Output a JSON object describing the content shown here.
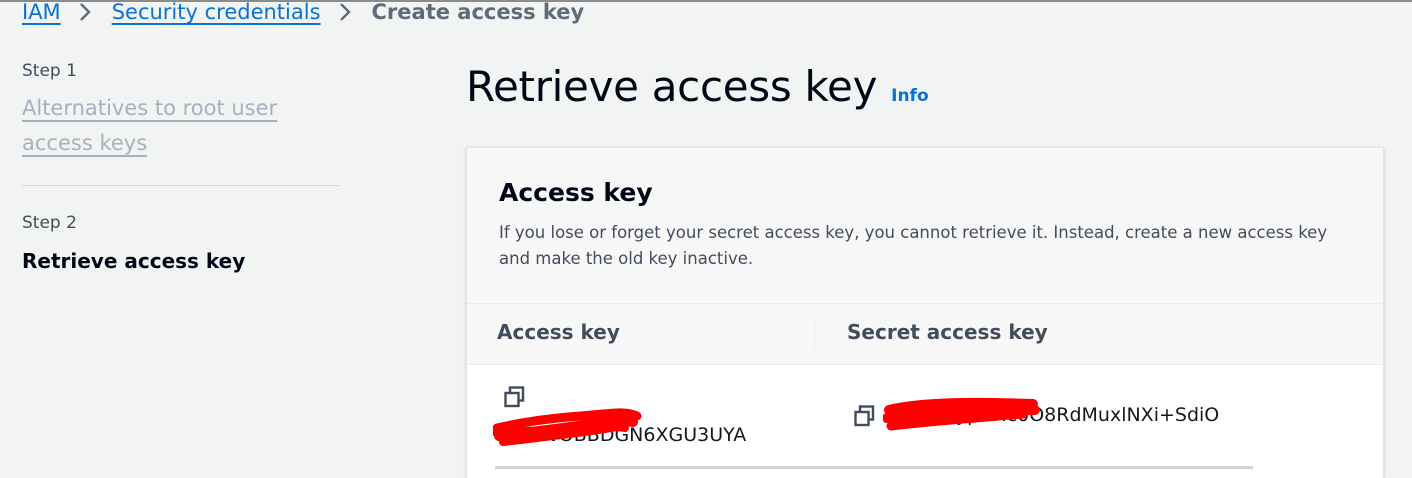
{
  "breadcrumb": {
    "items": [
      "IAM",
      "Security credentials"
    ],
    "current": "Create access key"
  },
  "side_nav": {
    "step1_label": "Step 1",
    "step1_title": "Alternatives to root user access keys",
    "step2_label": "Step 2",
    "step2_title": "Retrieve access key"
  },
  "page": {
    "title": "Retrieve access key",
    "info_label": "Info"
  },
  "panel": {
    "title": "Access key",
    "description": "If you lose or forget your secret access key, you cannot retrieve it. Instead, create a new access key and make the old key inactive.",
    "columns": [
      "Access key",
      "Secret access key"
    ],
    "access_key_value": "AKIAWOBBDGN6XGU3UYA",
    "secret_access_key_value": "Agi+giiypRHc0O8RdMuxlNXi+SdiO"
  },
  "colors": {
    "link": "#0972d3",
    "redaction": "#ff0000",
    "background": "#f2f3f3"
  },
  "icons": [
    "chevron-right-icon",
    "copy-icon"
  ]
}
